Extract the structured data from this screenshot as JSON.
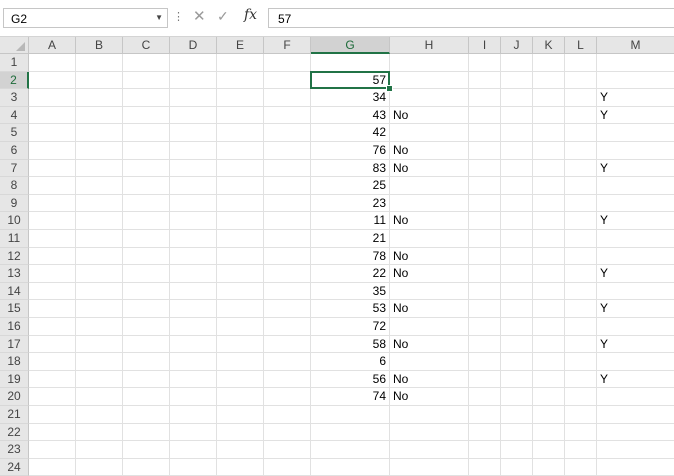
{
  "name_box": "G2",
  "formula_value": "57",
  "columns": [
    "A",
    "B",
    "C",
    "D",
    "E",
    "F",
    "G",
    "H",
    "I",
    "J",
    "K",
    "L",
    "M"
  ],
  "rows": [
    "1",
    "2",
    "3",
    "4",
    "5",
    "6",
    "7",
    "8",
    "9",
    "10",
    "11",
    "12",
    "13",
    "14",
    "15",
    "16",
    "17",
    "18",
    "19",
    "20",
    "21",
    "22",
    "23",
    "24"
  ],
  "selected_cell": "G2",
  "accent_color": "#217346",
  "col_g_values": [
    "",
    "57",
    "34",
    "43",
    "42",
    "76",
    "83",
    "25",
    "23",
    "11",
    "21",
    "78",
    "22",
    "35",
    "53",
    "72",
    "58",
    "6",
    "56",
    "74",
    "",
    "",
    "",
    ""
  ],
  "col_h_values": [
    "",
    "",
    "",
    "No",
    "",
    "No",
    "No",
    "",
    "",
    "No",
    "",
    "No",
    "No",
    "",
    "No",
    "",
    "No",
    "",
    "No",
    "No",
    "",
    "",
    "",
    ""
  ],
  "col_m_values": [
    "",
    "",
    "Y",
    "Y",
    "",
    "",
    "Y",
    "",
    "",
    "Y",
    "",
    "",
    "Y",
    "",
    "Y",
    "",
    "Y",
    "",
    "Y",
    "",
    "",
    "",
    "",
    ""
  ]
}
